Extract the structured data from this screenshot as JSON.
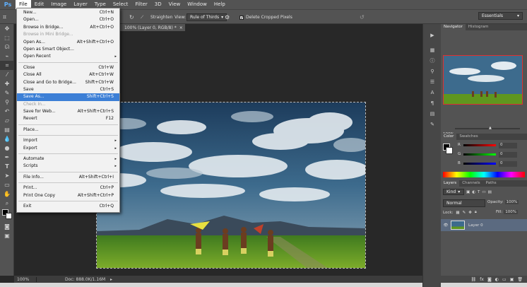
{
  "menubar": {
    "logo": "Ps",
    "items": [
      "File",
      "Edit",
      "Image",
      "Layer",
      "Type",
      "Select",
      "Filter",
      "3D",
      "View",
      "Window",
      "Help"
    ]
  },
  "options": {
    "straighten": "Straighten",
    "view_label": "View:",
    "view_value": "Rule of Thirds",
    "delete_cropped": "Delete Cropped Pixels",
    "workspace": "Essentials"
  },
  "document": {
    "tab_title": "100% (Layer 0, RGB/8) *",
    "zoom": "100%",
    "doc_info": "Doc: 888.0K/1.16M"
  },
  "file_menu": [
    {
      "label": "New...",
      "shortcut": "Ctrl+N"
    },
    {
      "label": "Open...",
      "shortcut": "Ctrl+O"
    },
    {
      "label": "Browse in Bridge...",
      "shortcut": "Alt+Ctrl+O"
    },
    {
      "label": "Browse in Mini Bridge...",
      "shortcut": "",
      "disabled": true
    },
    {
      "label": "Open As...",
      "shortcut": "Alt+Shift+Ctrl+O"
    },
    {
      "label": "Open as Smart Object...",
      "shortcut": ""
    },
    {
      "label": "Open Recent",
      "shortcut": "",
      "submenu": true
    },
    {
      "sep": true
    },
    {
      "label": "Close",
      "shortcut": "Ctrl+W"
    },
    {
      "label": "Close All",
      "shortcut": "Alt+Ctrl+W"
    },
    {
      "label": "Close and Go to Bridge...",
      "shortcut": "Shift+Ctrl+W"
    },
    {
      "label": "Save",
      "shortcut": "Ctrl+S"
    },
    {
      "label": "Save As...",
      "shortcut": "Shift+Ctrl+S",
      "highlighted": true
    },
    {
      "label": "Check In...",
      "shortcut": "",
      "disabled": true
    },
    {
      "label": "Save for Web...",
      "shortcut": "Alt+Shift+Ctrl+S"
    },
    {
      "label": "Revert",
      "shortcut": "F12"
    },
    {
      "sep": true
    },
    {
      "label": "Place...",
      "shortcut": ""
    },
    {
      "sep": true
    },
    {
      "label": "Import",
      "shortcut": "",
      "submenu": true
    },
    {
      "label": "Export",
      "shortcut": "",
      "submenu": true
    },
    {
      "sep": true
    },
    {
      "label": "Automate",
      "shortcut": "",
      "submenu": true
    },
    {
      "label": "Scripts",
      "shortcut": "",
      "submenu": true
    },
    {
      "sep": true
    },
    {
      "label": "File Info...",
      "shortcut": "Alt+Shift+Ctrl+I"
    },
    {
      "sep": true
    },
    {
      "label": "Print...",
      "shortcut": "Ctrl+P"
    },
    {
      "label": "Print One Copy",
      "shortcut": "Alt+Shift+Ctrl+P"
    },
    {
      "sep": true
    },
    {
      "label": "Exit",
      "shortcut": "Ctrl+Q"
    }
  ],
  "navigator": {
    "tabs": [
      "Navigator",
      "Histogram"
    ],
    "zoom": "100%"
  },
  "color": {
    "tabs": [
      "Color",
      "Swatches"
    ],
    "channels": [
      {
        "label": "R",
        "value": "0"
      },
      {
        "label": "G",
        "value": "0"
      },
      {
        "label": "B",
        "value": "0"
      }
    ]
  },
  "layers": {
    "tabs": [
      "Layers",
      "Channels",
      "Paths"
    ],
    "kind": "Kind",
    "blend_mode": "Normal",
    "opacity_label": "Opacity:",
    "opacity": "100%",
    "lock_label": "Lock:",
    "fill_label": "Fill:",
    "fill": "100%",
    "items": [
      {
        "name": "Layer 0"
      }
    ]
  },
  "colors": {
    "accent": "#3c7fd6",
    "panel": "#535353",
    "canvas": "#282828"
  }
}
